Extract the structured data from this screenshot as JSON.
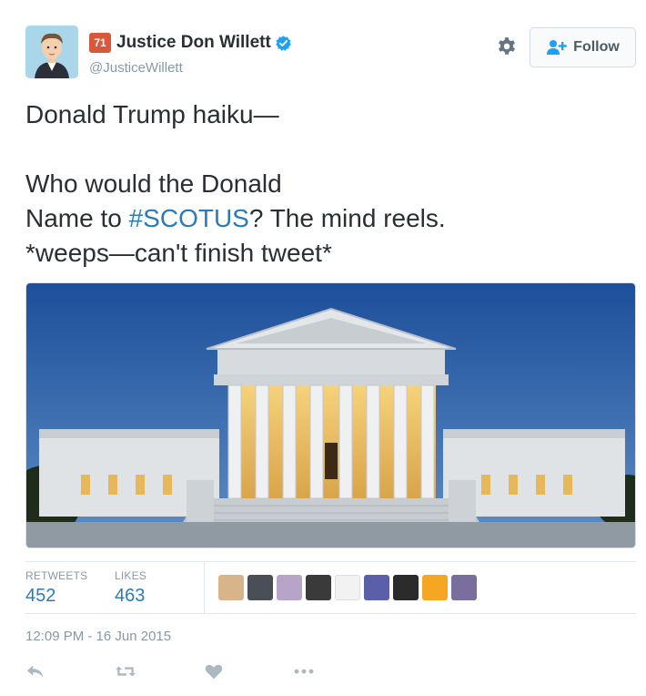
{
  "user": {
    "notification_count": "71",
    "display_name": "Justice Don Willett",
    "handle": "@JusticeWillett"
  },
  "follow_button": {
    "label": "Follow"
  },
  "tweet": {
    "line1": "Donald Trump haiku—",
    "line2": "Who would the Donald",
    "line3_before": "Name to ",
    "line3_hashtag": "#SCOTUS",
    "line3_after": "? The mind reels.",
    "line4": "*weeps—can't finish tweet*"
  },
  "stats": {
    "retweets_label": "RETWEETS",
    "retweets_value": "452",
    "likes_label": "LIKES",
    "likes_value": "463"
  },
  "timestamp": "12:09 PM - 16 Jun 2015",
  "icons": {
    "gear": "gear-icon",
    "follow": "add-user-icon",
    "verified": "verified-badge-icon",
    "reply": "reply-icon",
    "retweet": "retweet-icon",
    "like": "heart-icon",
    "more": "more-icon"
  },
  "colors": {
    "link": "#2b7bb9",
    "muted": "#8899a6",
    "text": "#292f33",
    "verified": "#1da1f2",
    "badge": "#d9573a"
  }
}
